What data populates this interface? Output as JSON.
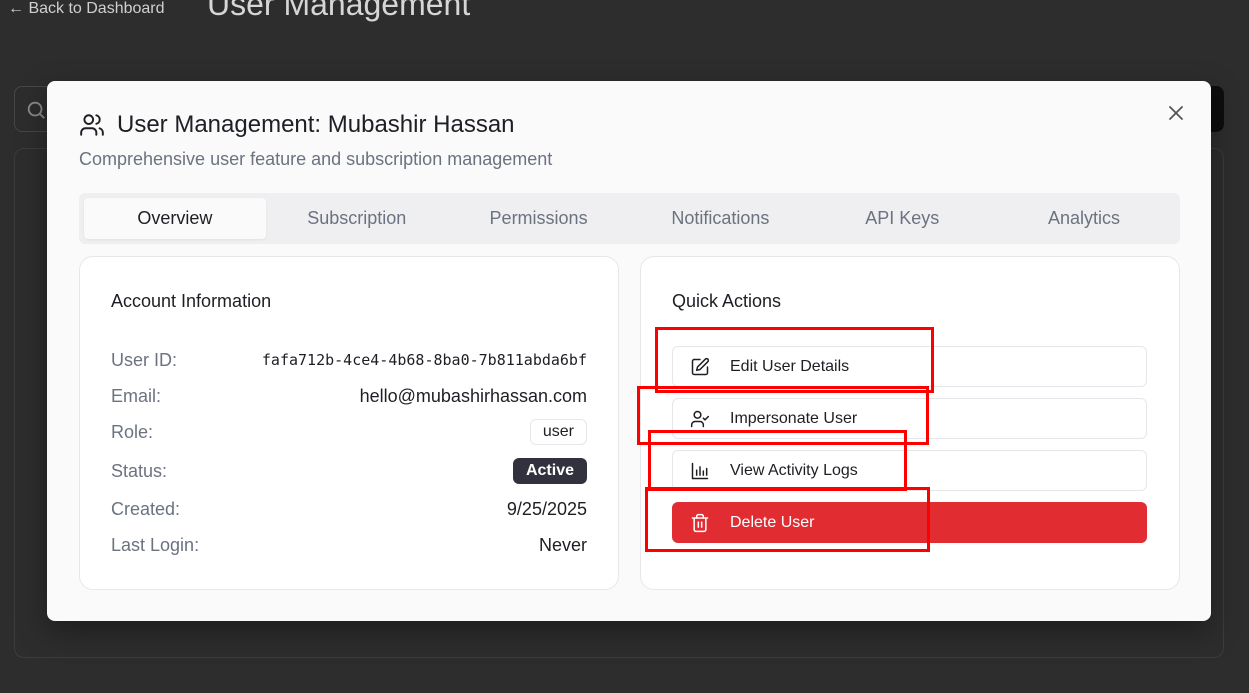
{
  "background": {
    "back_link": "← Back to Dashboard",
    "page_title": "User Management"
  },
  "modal": {
    "title": "User Management: Mubashir Hassan",
    "subtitle": "Comprehensive user feature and subscription management",
    "close_icon": "close-icon",
    "tabs": [
      {
        "label": "Overview",
        "active": true
      },
      {
        "label": "Subscription",
        "active": false
      },
      {
        "label": "Permissions",
        "active": false
      },
      {
        "label": "Notifications",
        "active": false
      },
      {
        "label": "API Keys",
        "active": false
      },
      {
        "label": "Analytics",
        "active": false
      }
    ],
    "account_info": {
      "heading": "Account Information",
      "user_id_label": "User ID:",
      "user_id_value": "fafa712b-4ce4-4b68-8ba0-7b811abda6bf",
      "email_label": "Email:",
      "email_value": "hello@mubashirhassan.com",
      "role_label": "Role:",
      "role_value": "user",
      "status_label": "Status:",
      "status_value": "Active",
      "created_label": "Created:",
      "created_value": "9/25/2025",
      "last_login_label": "Last Login:",
      "last_login_value": "Never"
    },
    "quick_actions": {
      "heading": "Quick Actions",
      "buttons": [
        {
          "label": "Edit User Details",
          "icon": "edit-icon"
        },
        {
          "label": "Impersonate User",
          "icon": "user-check-icon"
        },
        {
          "label": "View Activity Logs",
          "icon": "bar-chart-icon"
        },
        {
          "label": "Delete User",
          "icon": "trash-icon"
        }
      ]
    }
  },
  "colors": {
    "danger": "#e12d32",
    "status_badge": "#32323e",
    "annotation": "#ff0000"
  }
}
